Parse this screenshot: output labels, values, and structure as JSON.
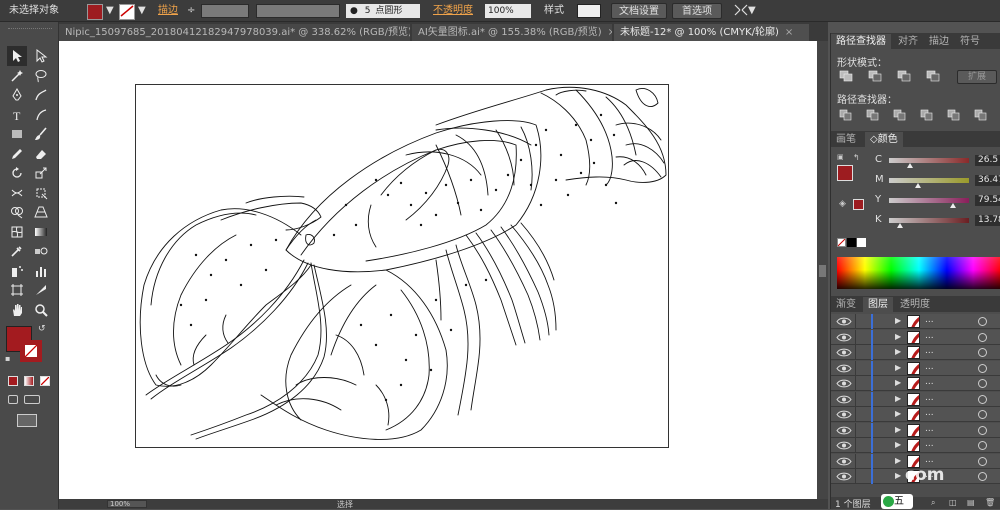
{
  "control_bar": {
    "selection_status": "未选择对象",
    "stroke_label": "描边",
    "stroke_weight_arrows": "÷",
    "brush_dot": "●",
    "brush_size": "5",
    "brush_label": "点圆形",
    "opacity_label": "不透明度",
    "opacity_value": "100%",
    "style_label": "样式",
    "doc_setup_button": "文档设置",
    "preferences_button": "首选项",
    "fill_color": "#9d1c20"
  },
  "document_tabs": [
    {
      "label": "Nipic_15097685_20180412182947978039.ai* @ 338.62% (RGB/预览)",
      "active": false
    },
    {
      "label": "AI矢量图标.ai* @ 155.38% (RGB/预览)",
      "active": false
    },
    {
      "label": "未标题-12* @ 100% (CMYK/轮廓)",
      "active": true
    }
  ],
  "tab_close_glyph": "×",
  "tools": [
    "selection-tool",
    "direct-selection-tool",
    "magic-wand-tool",
    "lasso-tool",
    "pen-tool",
    "curvature-tool",
    "type-tool",
    "line-segment-tool",
    "rectangle-tool",
    "paintbrush-tool",
    "pencil-tool",
    "eraser-tool",
    "rotate-tool",
    "scale-tool",
    "width-tool",
    "free-transform-tool",
    "shape-builder-tool",
    "perspective-grid-tool",
    "mesh-tool",
    "gradient-tool",
    "eyedropper-tool",
    "blend-tool",
    "symbol-sprayer-tool",
    "column-graph-tool",
    "artboard-tool",
    "slice-tool",
    "hand-tool",
    "zoom-tool"
  ],
  "tool_letter_glyphs": {
    "type": "T"
  },
  "toolbox_fill_color": "#a31b1f",
  "pathfinder_panel": {
    "tabs": [
      "路径查找器",
      "对齐",
      "描边",
      "符号"
    ],
    "shape_modes_label": "形状模式：",
    "expand_button": "扩展",
    "pathfinders_label": "路径查找器："
  },
  "color_panel": {
    "tabs": [
      "画笔",
      "颜色"
    ],
    "mode_glyph": "◇",
    "channels": [
      {
        "label": "C",
        "value": "26.5",
        "position": 0.26,
        "track_color": "#8a2a2a"
      },
      {
        "label": "M",
        "value": "36.47",
        "position": 0.36,
        "track_color": "#9a9a2a"
      },
      {
        "label": "Y",
        "value": "79.54",
        "position": 0.8,
        "track_color": "#8a1f5a"
      },
      {
        "label": "K",
        "value": "13.78",
        "position": 0.14,
        "track_color": "#6a1f22"
      }
    ]
  },
  "layers_panel": {
    "tabs": [
      "渐变",
      "图层",
      "透明度"
    ],
    "row_name": "...",
    "rows": 11,
    "layer_count": "1 个图层",
    "watermark_text": "五",
    "watermark_suffix": "com"
  },
  "status_bar": {
    "zoom": "100%",
    "tool_name": "选择"
  }
}
